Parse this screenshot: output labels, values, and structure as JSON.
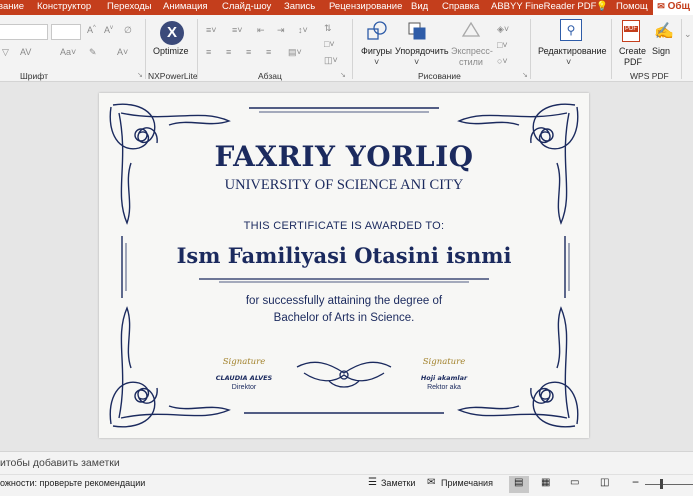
{
  "tabs": [
    {
      "label": "вание"
    },
    {
      "label": "Конструктор"
    },
    {
      "label": "Переходы"
    },
    {
      "label": "Анимация"
    },
    {
      "label": "Слайд-шоу"
    },
    {
      "label": "Запись"
    },
    {
      "label": "Рецензирование"
    },
    {
      "label": "Вид"
    },
    {
      "label": "Справка"
    },
    {
      "label": "ABBYY FineReader PDF"
    },
    {
      "label": "Помощ"
    },
    {
      "label": "Общ"
    }
  ],
  "ribbon": {
    "groups": {
      "font": "Шрифт",
      "nxpowerlite": "NXPowerLite",
      "paragraph": "Абзац",
      "drawing": "Рисование",
      "wps": "WPS PDF"
    },
    "optimize": "Optimize",
    "shapes": "Фигуры",
    "arrange": "Упорядочить",
    "quick_styles_1": "Экспресс-",
    "quick_styles_2": "стили",
    "editing": "Редактирование",
    "create_pdf_1": "Create",
    "create_pdf_2": "PDF",
    "sign": "Sign",
    "pdf_badge": "PDF"
  },
  "slide": {
    "title": "FAXRIY YORLIQ",
    "subtitle": "UNIVERSITY OF SCIENCE ANI CITY",
    "awarded": "THIS CERTIFICATE IS AWARDED TO:",
    "name": "Ism Familiyasi Otasini isnmi",
    "line1": "for successfully attaining the degree of",
    "line2": "Bachelor of Arts in Science.",
    "sig_left": {
      "script": "Signature",
      "name": "CLAUDIA ALVES",
      "role": "Direktor"
    },
    "sig_right": {
      "script": "Signature",
      "name": "Hoji akamlar",
      "role": "Rektor aka"
    }
  },
  "notes": {
    "placeholder": "итобы добавить заметки"
  },
  "status": {
    "accessibility": "ожности: проверьте рекомендации",
    "notes_btn": "Заметки",
    "comments_btn": "Примечания"
  },
  "colors": {
    "accent": "#c43e1c",
    "navy": "#1b2a5e",
    "gold": "#a3832d"
  }
}
